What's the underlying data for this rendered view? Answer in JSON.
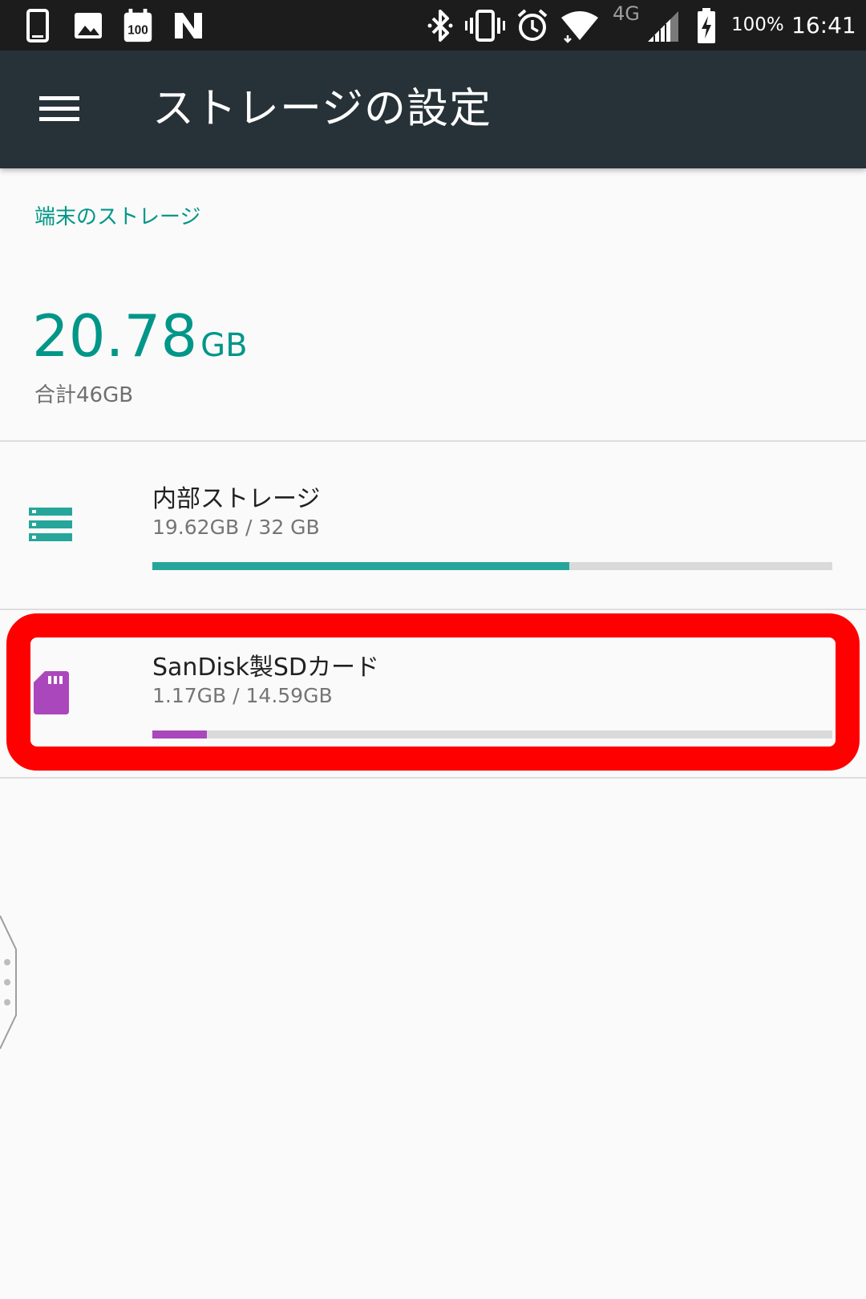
{
  "status_bar": {
    "battery_percent": "100%",
    "time": "16:41",
    "network_type": "4G",
    "left_icons": [
      "phone-icon",
      "image-icon",
      "calendar-100-icon",
      "n-icon"
    ],
    "right_icons": [
      "bluetooth-icon",
      "vibrate-icon",
      "alarm-icon",
      "wifi-icon",
      "signal-icon",
      "battery-charging-icon"
    ]
  },
  "app_bar": {
    "title": "ストレージの設定",
    "menu_icon": "hamburger-menu-icon"
  },
  "device_storage": {
    "section_label": "端末のストレージ",
    "used_value": "20.78",
    "used_unit": "GB",
    "total_label": "合計46GB"
  },
  "volumes": [
    {
      "name": "内部ストレージ",
      "usage": "19.62GB / 32 GB",
      "fraction_used": 0.613,
      "icon": "storage-icon",
      "color": "#26a69a"
    },
    {
      "name": "SanDisk製SDカード",
      "usage": "1.17GB / 14.59GB",
      "fraction_used": 0.08,
      "icon": "sd-card-icon",
      "color": "#ab47bc"
    }
  ],
  "colors": {
    "accent": "#009688",
    "app_bar": "#263238",
    "status_bar": "#1c1c1c",
    "highlight": "#ff0000"
  }
}
